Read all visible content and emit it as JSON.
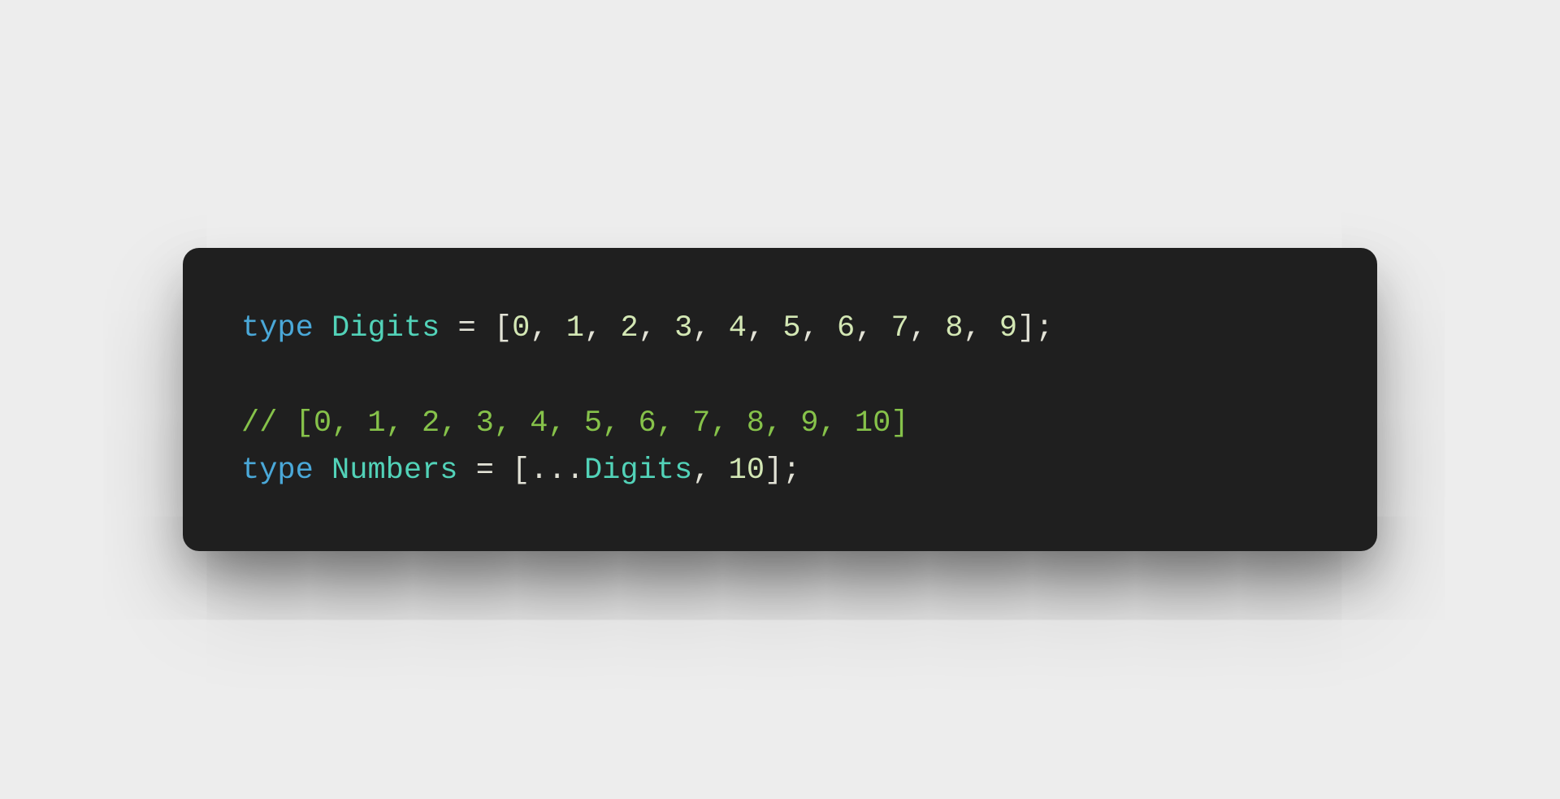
{
  "code": {
    "lines": [
      {
        "tokens": [
          {
            "cls": "tok-kw",
            "txt": "type"
          },
          {
            "cls": "",
            "txt": " "
          },
          {
            "cls": "tok-type",
            "txt": "Digits"
          },
          {
            "cls": "",
            "txt": " "
          },
          {
            "cls": "tok-op",
            "txt": "="
          },
          {
            "cls": "",
            "txt": " "
          },
          {
            "cls": "tok-op",
            "txt": "["
          },
          {
            "cls": "tok-num",
            "txt": "0"
          },
          {
            "cls": "tok-op",
            "txt": ", "
          },
          {
            "cls": "tok-num",
            "txt": "1"
          },
          {
            "cls": "tok-op",
            "txt": ", "
          },
          {
            "cls": "tok-num",
            "txt": "2"
          },
          {
            "cls": "tok-op",
            "txt": ", "
          },
          {
            "cls": "tok-num",
            "txt": "3"
          },
          {
            "cls": "tok-op",
            "txt": ", "
          },
          {
            "cls": "tok-num",
            "txt": "4"
          },
          {
            "cls": "tok-op",
            "txt": ", "
          },
          {
            "cls": "tok-num",
            "txt": "5"
          },
          {
            "cls": "tok-op",
            "txt": ", "
          },
          {
            "cls": "tok-num",
            "txt": "6"
          },
          {
            "cls": "tok-op",
            "txt": ", "
          },
          {
            "cls": "tok-num",
            "txt": "7"
          },
          {
            "cls": "tok-op",
            "txt": ", "
          },
          {
            "cls": "tok-num",
            "txt": "8"
          },
          {
            "cls": "tok-op",
            "txt": ", "
          },
          {
            "cls": "tok-num",
            "txt": "9"
          },
          {
            "cls": "tok-op",
            "txt": "];"
          }
        ]
      },
      {
        "tokens": [
          {
            "cls": "",
            "txt": " "
          }
        ]
      },
      {
        "tokens": [
          {
            "cls": "tok-cmt",
            "txt": "// [0, 1, 2, 3, 4, 5, 6, 7, 8, 9, 10]"
          }
        ]
      },
      {
        "tokens": [
          {
            "cls": "tok-kw",
            "txt": "type"
          },
          {
            "cls": "",
            "txt": " "
          },
          {
            "cls": "tok-type",
            "txt": "Numbers"
          },
          {
            "cls": "",
            "txt": " "
          },
          {
            "cls": "tok-op",
            "txt": "="
          },
          {
            "cls": "",
            "txt": " "
          },
          {
            "cls": "tok-op",
            "txt": "[..."
          },
          {
            "cls": "tok-type",
            "txt": "Digits"
          },
          {
            "cls": "tok-op",
            "txt": ", "
          },
          {
            "cls": "tok-num",
            "txt": "10"
          },
          {
            "cls": "tok-op",
            "txt": "];"
          }
        ]
      }
    ]
  }
}
